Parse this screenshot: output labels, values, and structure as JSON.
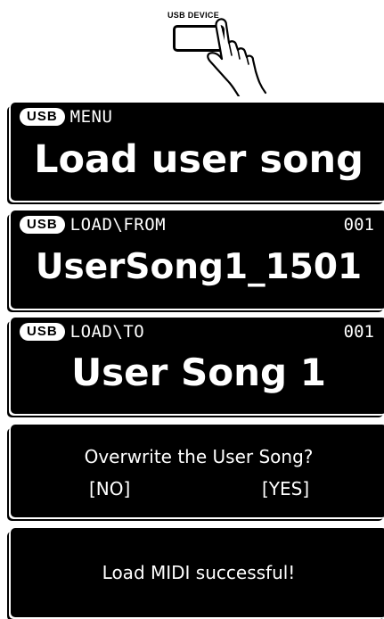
{
  "usb_button": {
    "label": "USB DEVICE"
  },
  "panels": [
    {
      "badge": "USB",
      "header": "MENU",
      "counter": "",
      "main": "Load user song"
    },
    {
      "badge": "USB",
      "header": "LOAD\\FROM",
      "counter": "001",
      "main": "UserSong1_1501"
    },
    {
      "badge": "USB",
      "header": "LOAD\\TO",
      "counter": "001",
      "main": "User Song 1"
    }
  ],
  "confirm_dialog": {
    "question": "Overwrite the User Song?",
    "no_label": "[NO]",
    "yes_label": "[YES]"
  },
  "result": {
    "message": "Load MIDI successful!"
  },
  "colors": {
    "screen_bg": "#000000",
    "screen_text": "#ffffff",
    "page_bg": "#ffffff"
  }
}
